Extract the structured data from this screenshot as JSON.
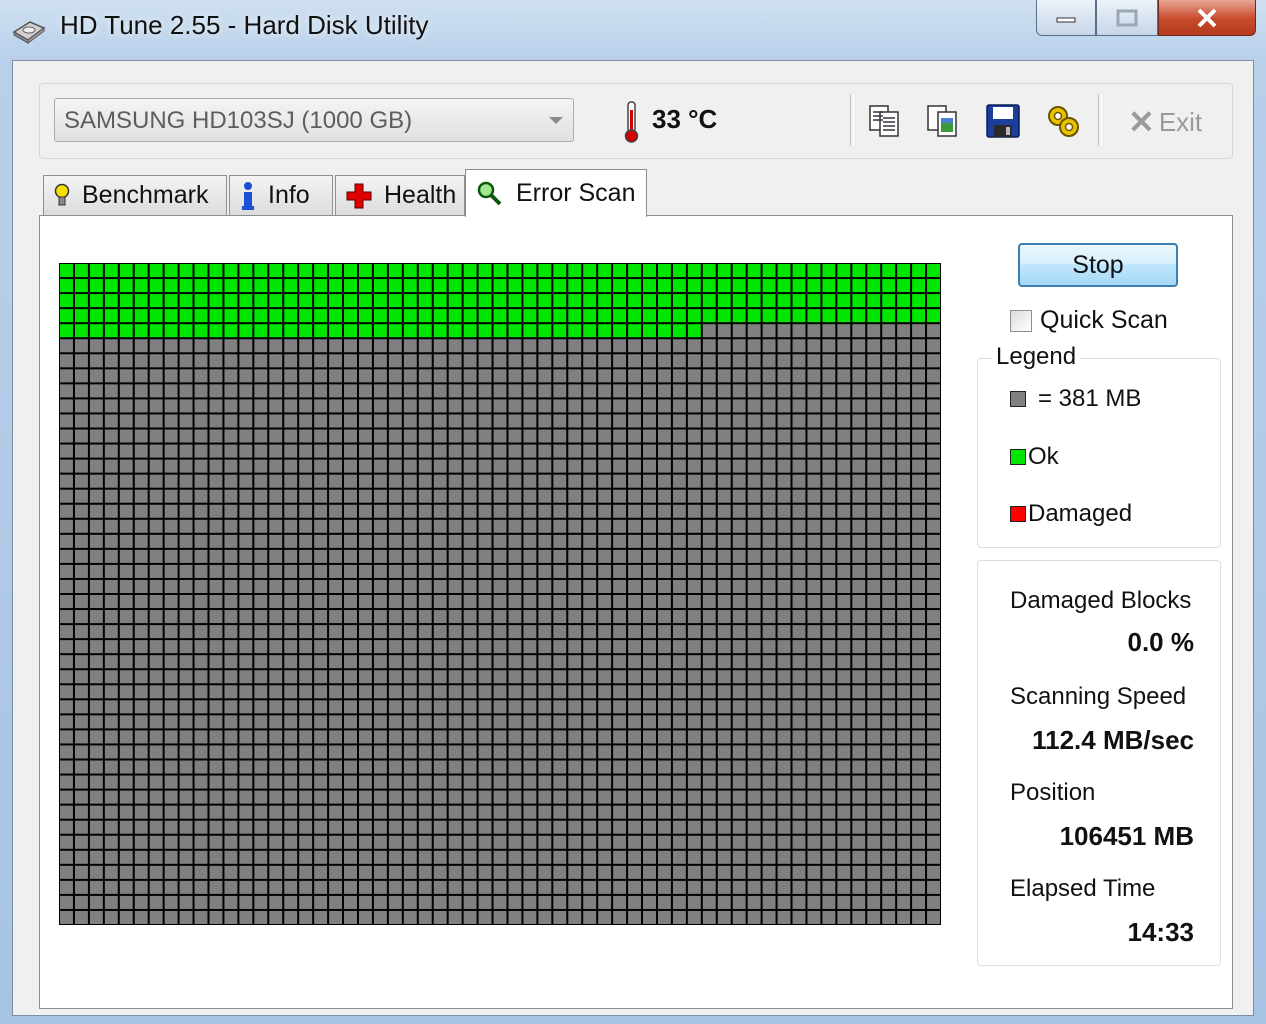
{
  "window": {
    "title": "HD Tune 2.55 - Hard Disk Utility"
  },
  "toolbar": {
    "drive": "SAMSUNG HD103SJ (1000 GB)",
    "temperature": "33 °C",
    "exit_label": "Exit",
    "icons": [
      "copy-text-icon",
      "copy-image-icon",
      "save-icon",
      "options-icon"
    ]
  },
  "tabs": [
    {
      "label": "Benchmark",
      "icon": "bulb-icon"
    },
    {
      "label": "Info",
      "icon": "info-icon"
    },
    {
      "label": "Health",
      "icon": "health-cross-icon"
    },
    {
      "label": "Error Scan",
      "icon": "magnifier-icon",
      "active": true
    }
  ],
  "scan": {
    "stop_label": "Stop",
    "quick_scan_label": "Quick Scan",
    "quick_scan_checked": false
  },
  "legend": {
    "title": "Legend",
    "block_size": "= 381 MB",
    "ok": "Ok",
    "damaged": "Damaged"
  },
  "stats": {
    "damaged_blocks_label": "Damaged Blocks",
    "damaged_blocks_value": "0.0 %",
    "speed_label": "Scanning Speed",
    "speed_value": "112.4 MB/sec",
    "position_label": "Position",
    "position_value": "106451 MB",
    "elapsed_label": "Elapsed Time",
    "elapsed_value": "14:33"
  },
  "block_map": {
    "columns": 59,
    "rows": 44,
    "ok_blocks": 279,
    "damaged_blocks": 0
  },
  "colors": {
    "ok": "#00e600",
    "damaged": "#ff0000",
    "unscanned": "#808080",
    "grid_line": "#000000"
  }
}
